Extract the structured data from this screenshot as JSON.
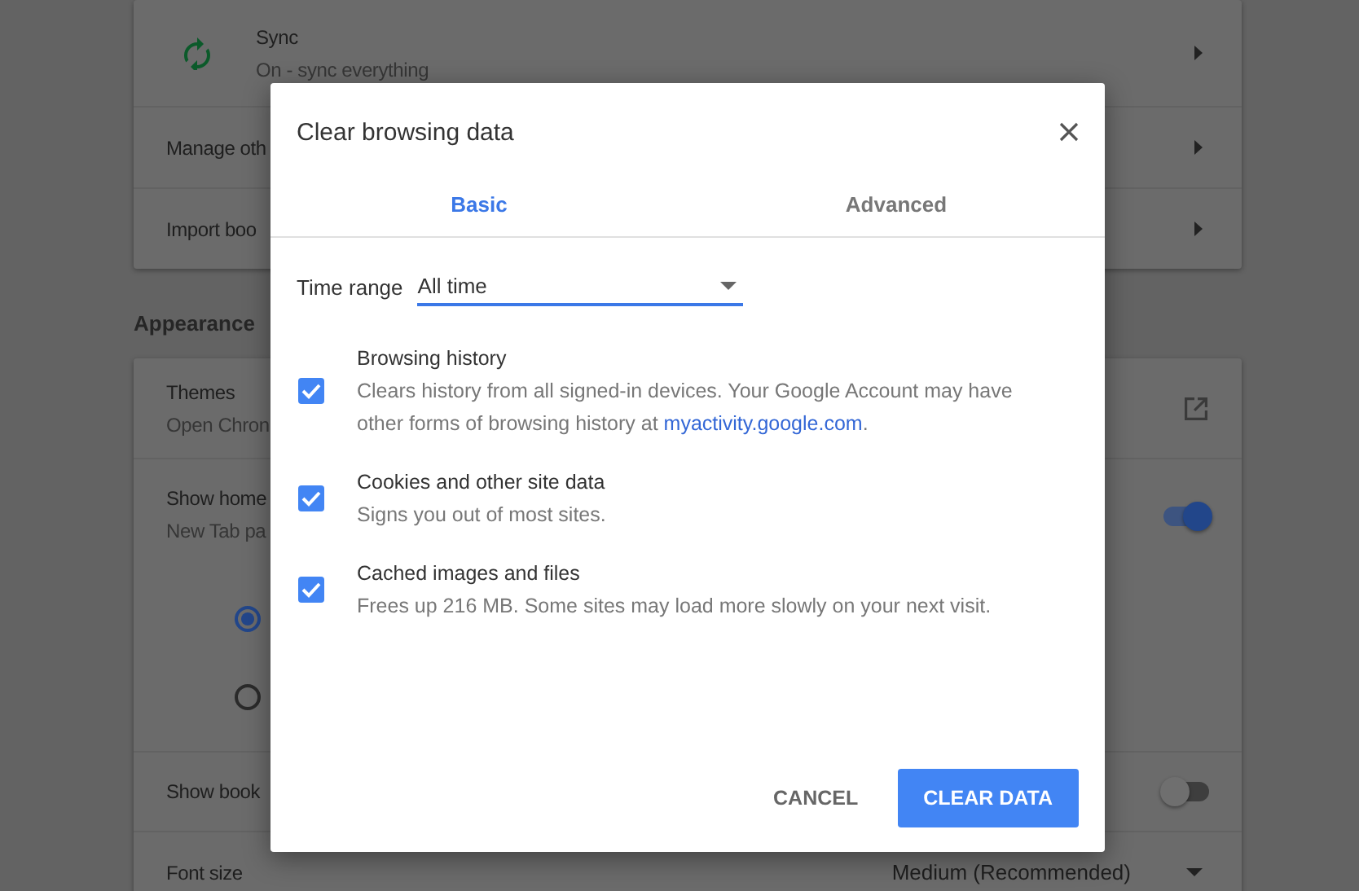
{
  "settings": {
    "people_card": [
      {
        "kind": "sync",
        "title": "Sync",
        "subtitle": "On - sync everything"
      },
      {
        "kind": "link",
        "title": "Manage oth"
      },
      {
        "kind": "link",
        "title": "Import boo"
      }
    ],
    "appearance_heading": "Appearance",
    "appearance_card": [
      {
        "kind": "external",
        "title": "Themes",
        "subtitle": "Open Chron"
      },
      {
        "kind": "toggle",
        "title": "Show home",
        "subtitle": "New Tab pa",
        "on": true,
        "radios": [
          {
            "selected": true
          },
          {
            "selected": false
          }
        ]
      },
      {
        "kind": "toggle",
        "title": "Show book",
        "on": false
      },
      {
        "kind": "select",
        "title": "Font size",
        "value": "Medium (Recommended)"
      }
    ]
  },
  "dialog": {
    "title": "Clear browsing data",
    "tabs": [
      {
        "label": "Basic",
        "selected": true
      },
      {
        "label": "Advanced",
        "selected": false
      }
    ],
    "time_range": {
      "label": "Time range",
      "value": "All time"
    },
    "items": [
      {
        "title": "Browsing history",
        "description": "Clears history from all signed-in devices. Your Google Account may have other forms of browsing history at",
        "link": "myactivity.google.com",
        "description_end": ".",
        "checked": true
      },
      {
        "title": "Cookies and other site data",
        "description": "Signs you out of most sites.",
        "checked": true
      },
      {
        "title": "Cached images and files",
        "description": "Frees up 216 MB. Some sites may load more slowly on your next visit.",
        "checked": true
      }
    ],
    "buttons": [
      {
        "label": "CANCEL",
        "kind": "text"
      },
      {
        "label": "CLEAR DATA",
        "kind": "primary"
      }
    ]
  }
}
